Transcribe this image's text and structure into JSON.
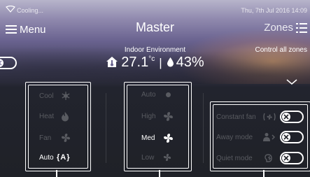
{
  "status": {
    "mode": "Cooling...",
    "datetime": "Thu, 7th Jul 2016  14:09"
  },
  "header": {
    "menu_label": "Menu",
    "title": "Master",
    "zones_label": "Zones"
  },
  "environment": {
    "label": "Indoor Environment",
    "temperature": "27.1",
    "temp_unit": "°c",
    "separator": "|",
    "humidity": "43%"
  },
  "control_all": {
    "label": "Control all zones",
    "on": false
  },
  "modes": [
    {
      "label": "Cool",
      "icon": "snowflake-icon",
      "active": false
    },
    {
      "label": "Heat",
      "icon": "flame-icon",
      "active": false
    },
    {
      "label": "Fan",
      "icon": "fan-icon",
      "active": false
    },
    {
      "label": "Auto",
      "icon_text": "{A}",
      "icon": "auto-mode-icon",
      "active": true
    }
  ],
  "fan_speeds": [
    {
      "label": "Auto",
      "icon": "dot-icon",
      "active": false
    },
    {
      "label": "High",
      "icon": "fan-icon",
      "active": false
    },
    {
      "label": "Med",
      "icon": "fan-icon",
      "active": true
    },
    {
      "label": "Low",
      "icon": "fan-icon",
      "active": false
    }
  ],
  "options": [
    {
      "label": "Constant fan",
      "icon": "constant-fan-icon",
      "on": false
    },
    {
      "label": "Away mode",
      "icon": "away-person-icon",
      "on": false
    },
    {
      "label": "Quiet mode",
      "icon": "quiet-icon",
      "on": false
    }
  ],
  "colors": {
    "text_dim": "#595b61",
    "text_active": "#ffffff",
    "panel_bg": "#1f2127"
  }
}
